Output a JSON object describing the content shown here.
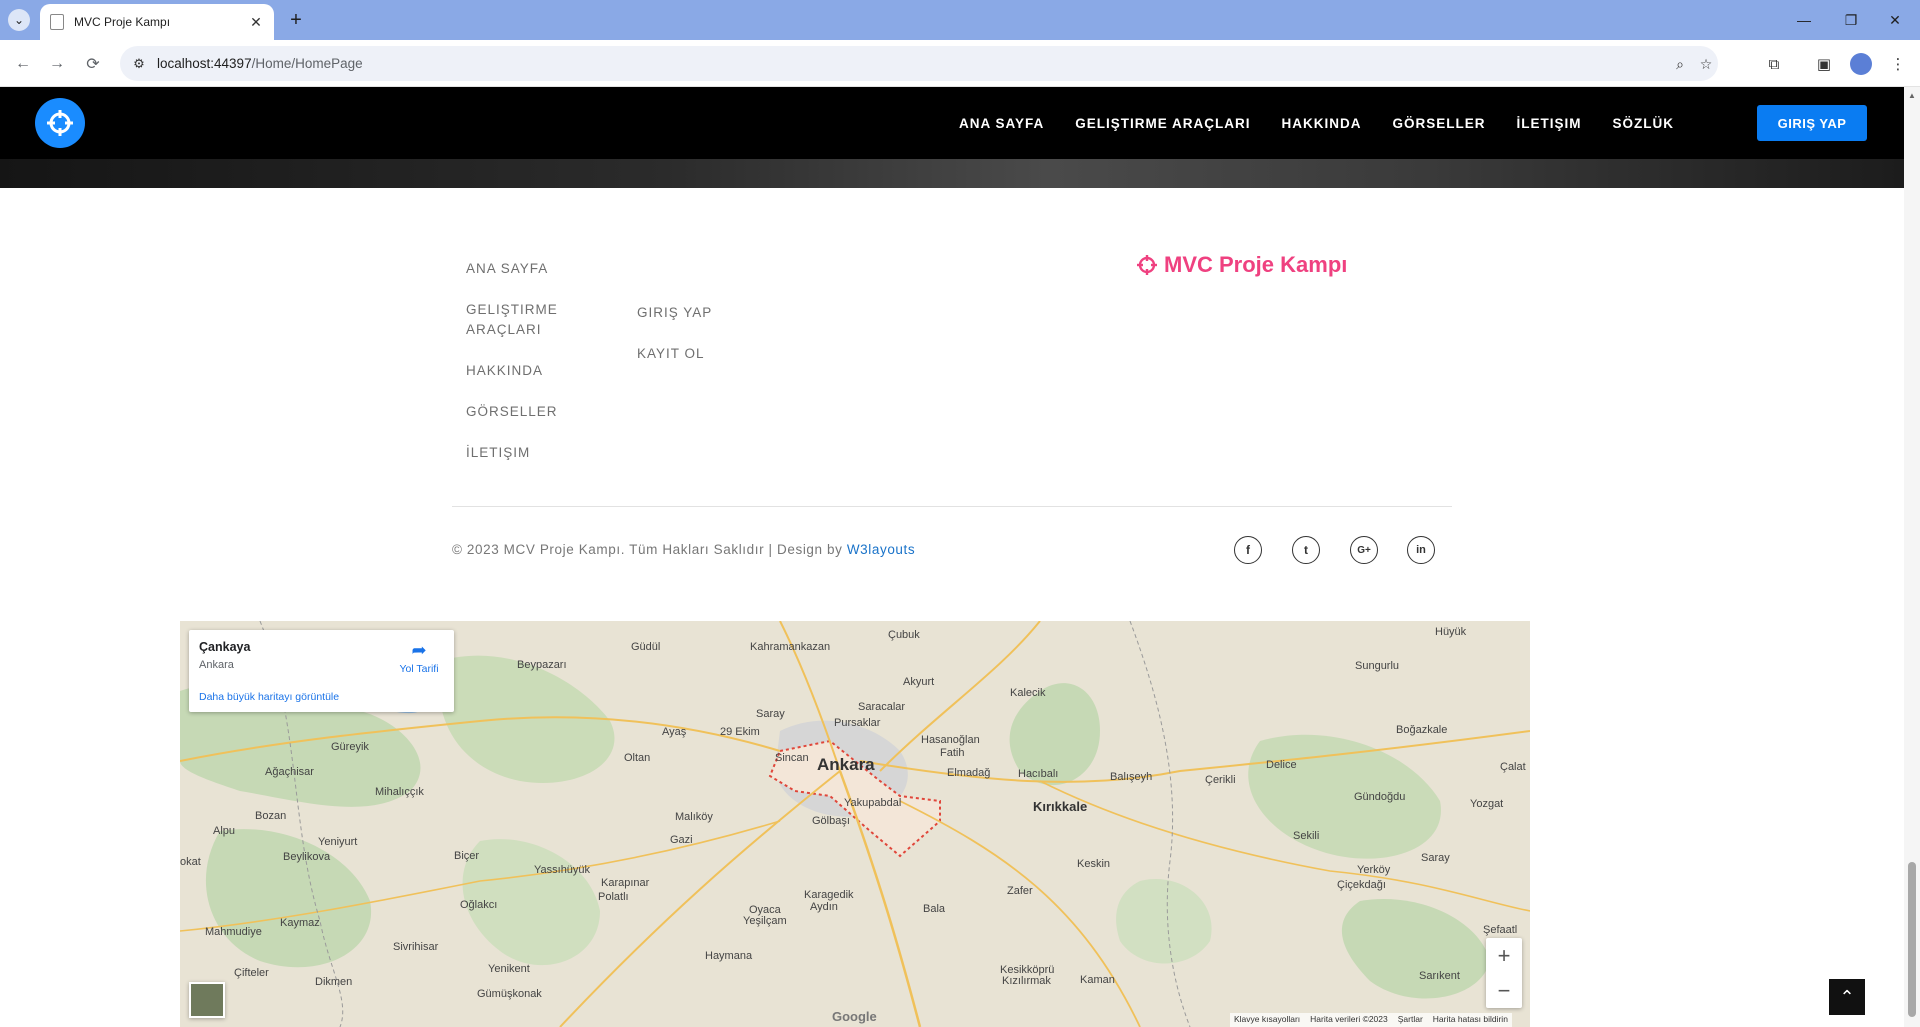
{
  "browser": {
    "tab_title": "MVC Proje Kampı",
    "url_host": "localhost:44397",
    "url_path": "/Home/HomePage"
  },
  "navbar": {
    "links": [
      "ANA SAYFA",
      "GELIŞTIRME ARAÇLARI",
      "HAKKINDA",
      "GÖRSELLER",
      "İLETIŞIM",
      "SÖZLÜK"
    ],
    "cta_label": "GIRIŞ YAP"
  },
  "footer": {
    "col1": [
      "ANA SAYFA",
      "GELIŞTIRME ARAÇLARI",
      "HAKKINDA",
      "GÖRSELLER",
      "İLETIŞIM"
    ],
    "col2": [
      "GIRIŞ YAP",
      "KAYIT OL"
    ],
    "brand": "MVC Proje Kampı",
    "copyright_text": "© 2023 MCV Proje Kampı. Tüm Hakları Saklıdır | Design by",
    "copyright_link": "W3layouts",
    "social": [
      "f",
      "t",
      "G+",
      "in"
    ],
    "colors": {
      "brand": "#ef4180",
      "accent": "#0a7cf2",
      "link": "#1a73c9"
    }
  },
  "map": {
    "info_title": "Çankaya",
    "info_subtitle": "Ankara",
    "directions_label": "Yol Tarifi",
    "bigger_map_link": "Daha büyük haritayı görüntüle",
    "zoom_in": "+",
    "zoom_out": "−",
    "google": "Google",
    "attributions": [
      "Klavye kısayolları",
      "Harita verileri ©2023",
      "Şartlar",
      "Harita hatası bildirin"
    ],
    "places_major": [
      "Ankara",
      "Kırıkkale"
    ],
    "places": [
      "Güdül",
      "Kahramankazan",
      "Çubuk",
      "Beypazarı",
      "Akyurt",
      "Kalecik",
      "Sungurlu",
      "Saray",
      "Saracalar",
      "Pursaklar",
      "Ayaş",
      "29 Ekim",
      "Sincan",
      "Hasanoğlan",
      "Fatih",
      "Boğazkale",
      "Güreyik",
      "Oltan",
      "Elmadağ",
      "Hacıbalı",
      "Balışeyh",
      "Çerikli",
      "Delice",
      "Ağaçhisar",
      "Mihalıççık",
      "Yakupabdal",
      "Gündoğdu",
      "Yozgat",
      "Malıköy",
      "Gölbaşı",
      "Alpu",
      "Bozan",
      "Sekili",
      "Çalat",
      "Yeniyurt",
      "Beylikova",
      "Gazi",
      "Biçer",
      "Keskin",
      "Saray",
      "okat",
      "Yassıhüyük",
      "Karapınar",
      "Polatlı",
      "Karagedik",
      "Aydın",
      "Zafer",
      "Yerköy",
      "Çiçekdağı",
      "Oğlakcı",
      "Oyaca",
      "Yeşilçam",
      "Bala",
      "Mahmudiye",
      "Kaymaz",
      "Sivrihisar",
      "Haymana",
      "Şefaatl",
      "Çifteler",
      "Yenikent",
      "Kesikköprü",
      "Kızılırmak",
      "Dikmen",
      "Gümüşkonak",
      "Kaman",
      "Sarıkent",
      "Hüyük"
    ]
  },
  "icons": {
    "logo": "crosshair-icon",
    "back_to_top": "chevron-up-icon"
  }
}
